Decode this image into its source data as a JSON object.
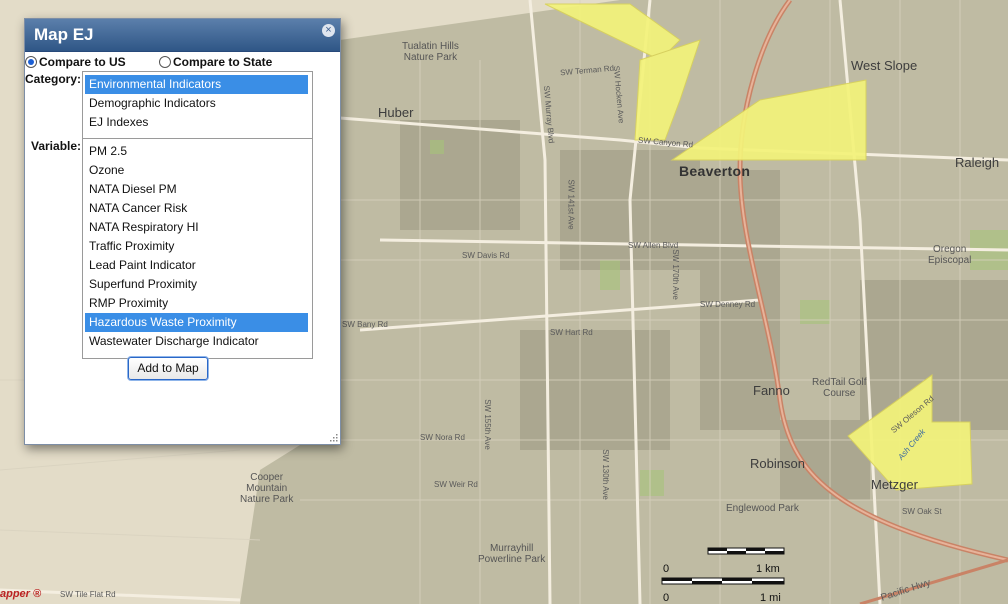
{
  "dialog": {
    "title": "Map EJ",
    "close_symbol": "×",
    "compare_us": "Compare to US",
    "compare_state": "Compare to State",
    "compare_selected": "us",
    "category_label": "Category:",
    "variable_label": "Variable:",
    "categories": [
      {
        "label": "Environmental Indicators",
        "selected": true
      },
      {
        "label": "Demographic Indicators",
        "selected": false
      },
      {
        "label": "EJ Indexes",
        "selected": false
      }
    ],
    "variables": [
      {
        "label": "PM 2.5",
        "selected": false
      },
      {
        "label": "Ozone",
        "selected": false
      },
      {
        "label": "NATA Diesel PM",
        "selected": false
      },
      {
        "label": "NATA Cancer Risk",
        "selected": false
      },
      {
        "label": "NATA Respiratory HI",
        "selected": false
      },
      {
        "label": "Traffic Proximity",
        "selected": false
      },
      {
        "label": "Lead Paint Indicator",
        "selected": false
      },
      {
        "label": "Superfund Proximity",
        "selected": false
      },
      {
        "label": "RMP Proximity",
        "selected": false
      },
      {
        "label": "Hazardous Waste Proximity",
        "selected": true
      },
      {
        "label": "Wastewater Discharge Indicator",
        "selected": false
      }
    ],
    "add_button": "Add to Map"
  },
  "map": {
    "places": {
      "west_slope": "West Slope",
      "raleigh": "Raleigh",
      "huber": "Huber",
      "beaverton": "Beaverton",
      "fanno": "Fanno",
      "robinson": "Robinson",
      "metzger": "Metzger",
      "tualatin_park": "Tualatin Hills\nNature Park",
      "cooper_park": "Cooper\nMountain\nNature Park",
      "murrayhill_park": "Murrayhill\nPowerline Park",
      "redtail": "RedTail Golf\nCourse",
      "oregon_episcopal": "Oregon\nEpiscopal",
      "englewood": "Englewood Park"
    },
    "roads": {
      "canyon": "SW Canyon Rd",
      "terman": "SW Terman Rd",
      "murray": "SW Murray Blvd",
      "hocken": "SW Hocken Ave",
      "allen": "SW Allen Blvd",
      "davis": "SW Davis Rd",
      "denney": "SW Denney Rd",
      "hart": "SW Hart Rd",
      "bany": "SW Bany Rd",
      "nora": "SW Nora Rd",
      "weir": "SW Weir Rd",
      "tile_flat": "SW Tile Flat Rd",
      "oak": "SW Oak St",
      "pacific": "Pacific Hwy",
      "oleson": "SW Oleson Rd",
      "ash_creek": "Ash Creek",
      "ave_155": "SW 155th Ave",
      "ave_170": "SW 170th Ave",
      "ave_130": "SW 130th Ave",
      "ave_141": "SW 141st Ave"
    },
    "highlight_color": "#f3f37a",
    "scale": {
      "zero_km": "0",
      "km": "1 km",
      "zero_mi": "0",
      "mi": "1 mi"
    },
    "logo": "apper ®"
  }
}
